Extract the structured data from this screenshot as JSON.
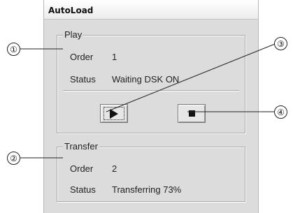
{
  "window": {
    "title": "AutoLoad"
  },
  "play": {
    "legend": "Play",
    "order_label": "Order",
    "order_value": "1",
    "status_label": "Status",
    "status_value": "Waiting DSK ON",
    "play_icon": "play-icon",
    "stop_icon": "stop-icon"
  },
  "transfer": {
    "legend": "Transfer",
    "order_label": "Order",
    "order_value": "2",
    "status_label": "Status",
    "status_value": "Transferring 73%"
  },
  "callouts": [
    "①",
    "②",
    "③",
    "④"
  ],
  "colors": {
    "window_bg": "#dcdcdc",
    "border": "#a8a8a8"
  }
}
